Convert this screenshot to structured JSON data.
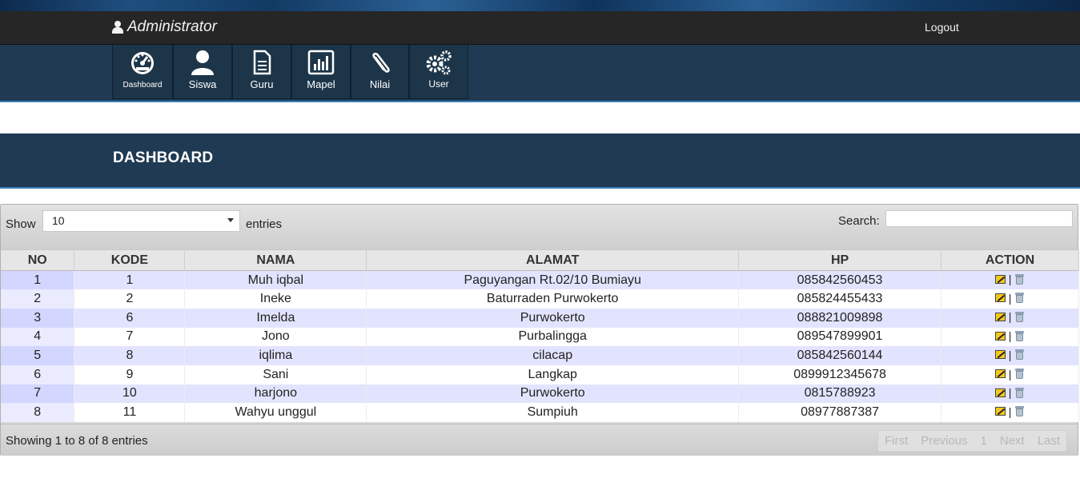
{
  "header": {
    "brand": "Administrator",
    "logout": "Logout"
  },
  "nav": {
    "items": [
      {
        "label": "Dashboard",
        "icon": "dashboard-gauge-icon"
      },
      {
        "label": "Siswa",
        "icon": "user-icon"
      },
      {
        "label": "Guru",
        "icon": "document-icon"
      },
      {
        "label": "Mapel",
        "icon": "bar-chart-icon"
      },
      {
        "label": "Nilai",
        "icon": "paperclip-icon"
      },
      {
        "label": "User",
        "icon": "gears-icon"
      }
    ]
  },
  "page": {
    "title": "DASHBOARD"
  },
  "table_controls": {
    "show_label": "Show",
    "page_size": "10",
    "entries_label": "entries",
    "search_label": "Search:",
    "search_value": ""
  },
  "table": {
    "columns": [
      "NO",
      "KODE",
      "NAMA",
      "ALAMAT",
      "HP",
      "ACTION"
    ],
    "rows": [
      {
        "no": "1",
        "kode": "1",
        "nama": "Muh iqbal",
        "alamat": "Paguyangan Rt.02/10 Bumiayu",
        "hp": "085842560453"
      },
      {
        "no": "2",
        "kode": "2",
        "nama": "Ineke",
        "alamat": "Baturraden Purwokerto",
        "hp": "085824455433"
      },
      {
        "no": "3",
        "kode": "6",
        "nama": "Imelda",
        "alamat": "Purwokerto",
        "hp": "088821009898"
      },
      {
        "no": "4",
        "kode": "7",
        "nama": "Jono",
        "alamat": "Purbalingga",
        "hp": "089547899901"
      },
      {
        "no": "5",
        "kode": "8",
        "nama": "iqlima",
        "alamat": "cilacap",
        "hp": "085842560144"
      },
      {
        "no": "6",
        "kode": "9",
        "nama": "Sani",
        "alamat": "Langkap",
        "hp": "0899912345678"
      },
      {
        "no": "7",
        "kode": "10",
        "nama": "harjono",
        "alamat": "Purwokerto",
        "hp": "0815788923"
      },
      {
        "no": "8",
        "kode": "11",
        "nama": "Wahyu unggul",
        "alamat": "Sumpiuh",
        "hp": "08977887387"
      }
    ],
    "action_separator": "|"
  },
  "footer": {
    "info": "Showing 1 to 8 of 8 entries",
    "pager": {
      "first": "First",
      "previous": "Previous",
      "page": "1",
      "next": "Next",
      "last": "Last"
    }
  },
  "colors": {
    "navbar": "#1f3a52",
    "topbar": "#262626",
    "row_odd": "#e2e4ff",
    "accent_border": "#3a7fb5"
  }
}
